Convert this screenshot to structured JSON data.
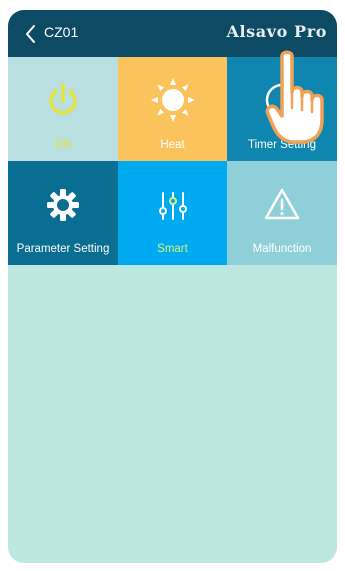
{
  "header": {
    "device_name": "CZ01",
    "brand": "Alsavo Pro"
  },
  "colors": {
    "header_bg": "#0d4a63",
    "screen_bg": "#bde8e2",
    "on_tile": "#b9dfe0",
    "on_accent": "#e6e43a",
    "heat_tile": "#fbc35c",
    "timer_tile": "#0f86b0",
    "parameter_tile": "#0a6d92",
    "smart_tile": "#00aaf0",
    "smart_accent": "#d7f07c",
    "malfunction_tile": "#8fd0d8",
    "pointer_fill": "#ffffff",
    "pointer_stroke": "#f2a154"
  },
  "tiles": [
    {
      "label": "ON",
      "icon": "power-icon"
    },
    {
      "label": "Heat",
      "icon": "sun-icon"
    },
    {
      "label": "Timer Setting",
      "icon": "clock-icon"
    },
    {
      "label": "Parameter Setting",
      "icon": "gear-icon"
    },
    {
      "label": "Smart",
      "icon": "sliders-icon"
    },
    {
      "label": "Malfunction",
      "icon": "warning-icon"
    }
  ]
}
